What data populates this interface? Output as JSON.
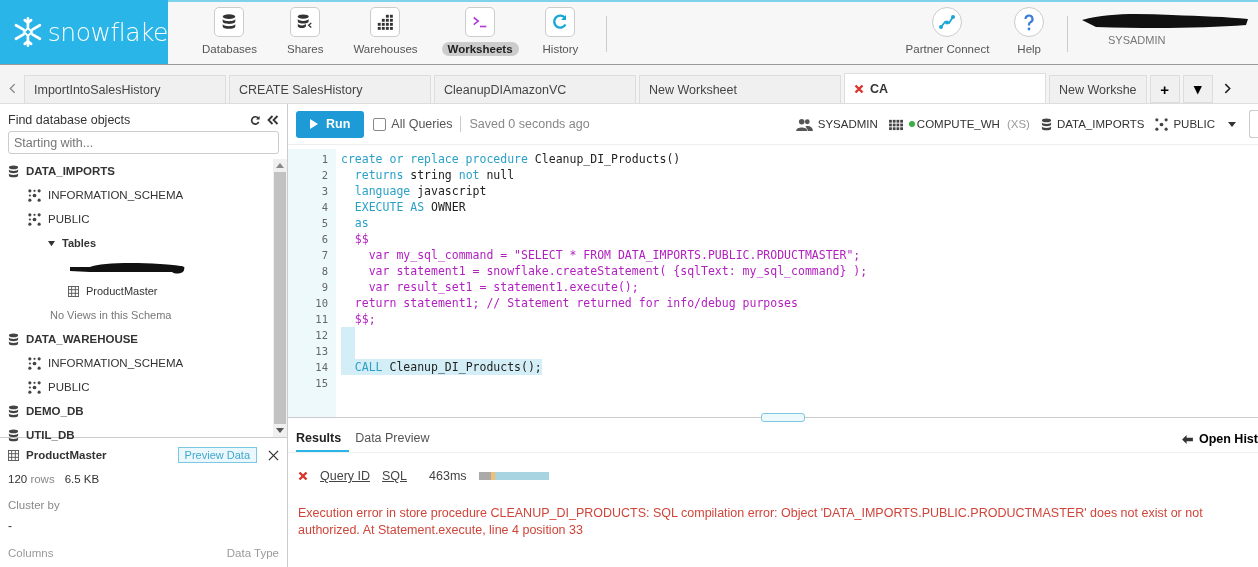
{
  "brand": {
    "name": "snowflake"
  },
  "nav": [
    {
      "label": "Databases",
      "selected": false
    },
    {
      "label": "Shares",
      "selected": false
    },
    {
      "label": "Warehouses",
      "selected": false
    },
    {
      "label": "Worksheets",
      "selected": true
    },
    {
      "label": "History",
      "selected": false
    }
  ],
  "nav_right": [
    {
      "label": "Partner Connect"
    },
    {
      "label": "Help"
    }
  ],
  "user": {
    "role": "SYSADMIN"
  },
  "tabs": [
    {
      "label": "ImportIntoSalesHistory",
      "selected": false,
      "error": false
    },
    {
      "label": "CREATE SalesHistory",
      "selected": false,
      "error": false
    },
    {
      "label": "CleanupDIAmazonVC",
      "selected": false,
      "error": false
    },
    {
      "label": "New Worksheet",
      "selected": false,
      "error": false
    },
    {
      "label": "CA",
      "selected": true,
      "error": true
    },
    {
      "label": "New Workshe",
      "selected": false,
      "error": false
    }
  ],
  "tab_actions": [
    "+",
    "▾"
  ],
  "sidebar": {
    "title": "Find database objects",
    "search": {
      "placeholder": "Starting with..."
    },
    "tree": [
      {
        "kind": "database",
        "label": "DATA_IMPORTS",
        "children": [
          {
            "kind": "schema",
            "label": "INFORMATION_SCHEMA"
          },
          {
            "kind": "schema",
            "label": "PUBLIC",
            "children": [
              {
                "kind": "folder",
                "label": "Tables",
                "expanded": true,
                "children": [
                  {
                    "kind": "redacted"
                  },
                  {
                    "kind": "table",
                    "label": "ProductMaster"
                  }
                ]
              },
              {
                "kind": "note",
                "label": "No Views in this Schema"
              }
            ]
          }
        ]
      },
      {
        "kind": "database",
        "label": "DATA_WAREHOUSE",
        "children": [
          {
            "kind": "schema",
            "label": "INFORMATION_SCHEMA"
          },
          {
            "kind": "schema",
            "label": "PUBLIC"
          }
        ]
      },
      {
        "kind": "database",
        "label": "DEMO_DB"
      },
      {
        "kind": "database",
        "label": "UTIL_DB"
      }
    ],
    "details": {
      "name": "ProductMaster",
      "action": "Preview Data",
      "rows": "120",
      "rows_label": "rows",
      "size": "6.5 KB",
      "cluster_label": "Cluster by",
      "cluster_value": "-",
      "columns_label": "Columns",
      "type_label": "Data Type"
    }
  },
  "toolbar": {
    "run": "Run",
    "all_queries": {
      "label": "All Queries",
      "checked": false
    },
    "saved": "Saved 0 seconds ago",
    "role": "SYSADMIN",
    "warehouse": "COMPUTE_WH",
    "warehouse_running": true,
    "size": "(XS)",
    "database": "DATA_IMPORTS",
    "schema": "PUBLIC"
  },
  "editor": {
    "lines": [
      {
        "n": "1",
        "selected": false,
        "segments": [
          {
            "kind": "keyword",
            "text": "create or replace procedure"
          },
          {
            "kind": "plain",
            "text": " Cleanup_DI_Products()"
          }
        ]
      },
      {
        "n": "2",
        "selected": false,
        "segments": [
          {
            "kind": "keyword",
            "text": "  returns"
          },
          {
            "kind": "plain",
            "text": " string "
          },
          {
            "kind": "keyword",
            "text": "not"
          },
          {
            "kind": "plain",
            "text": " null"
          }
        ]
      },
      {
        "n": "3",
        "selected": false,
        "segments": [
          {
            "kind": "keyword",
            "text": "  language"
          },
          {
            "kind": "plain",
            "text": " javascript"
          }
        ]
      },
      {
        "n": "4",
        "selected": false,
        "segments": [
          {
            "kind": "keyword",
            "text": "  EXECUTE AS"
          },
          {
            "kind": "plain",
            "text": " OWNER"
          }
        ]
      },
      {
        "n": "5",
        "selected": false,
        "segments": [
          {
            "kind": "keyword",
            "text": "  as"
          }
        ]
      },
      {
        "n": "6",
        "selected": false,
        "segments": [
          {
            "kind": "script",
            "text": "  $$"
          }
        ]
      },
      {
        "n": "7",
        "selected": false,
        "segments": [
          {
            "kind": "script",
            "text": "    var my_sql_command = \"SELECT * FROM DATA_IMPORTS.PUBLIC.PRODUCTMASTER\";"
          }
        ]
      },
      {
        "n": "8",
        "selected": false,
        "segments": [
          {
            "kind": "script",
            "text": "    var statement1 = snowflake.createStatement( {sqlText: my_sql_command} );"
          }
        ]
      },
      {
        "n": "9",
        "selected": false,
        "segments": [
          {
            "kind": "script",
            "text": "    var result_set1 = statement1.execute();"
          }
        ]
      },
      {
        "n": "10",
        "selected": false,
        "segments": [
          {
            "kind": "script",
            "text": "  return statement1; // Statement returned for info/debug purposes"
          }
        ]
      },
      {
        "n": "11",
        "selected": false,
        "segments": [
          {
            "kind": "script",
            "text": "  $$;"
          }
        ]
      },
      {
        "n": "12",
        "selected": true
      },
      {
        "n": "13",
        "selected": true
      },
      {
        "n": "14",
        "selected": true,
        "segments": [
          {
            "kind": "keyword",
            "text": "  CALL"
          },
          {
            "kind": "plain",
            "text": " Cleanup_DI_Products();"
          }
        ]
      },
      {
        "n": "15",
        "selected": false
      }
    ]
  },
  "results": {
    "tabs": [
      {
        "label": "Results",
        "selected": true
      },
      {
        "label": "Data Preview",
        "selected": false
      }
    ],
    "open_history": "Open Hist",
    "query": {
      "failed": true,
      "query_id": "Query ID",
      "sql": "SQL",
      "duration": "463ms"
    },
    "message": "Execution error in store procedure CLEANUP_DI_PRODUCTS: SQL compilation error: Object 'DATA_IMPORTS.PUBLIC.PRODUCTMASTER' does not exist or not authorized. At Statement.execute, line 4 position 33"
  }
}
